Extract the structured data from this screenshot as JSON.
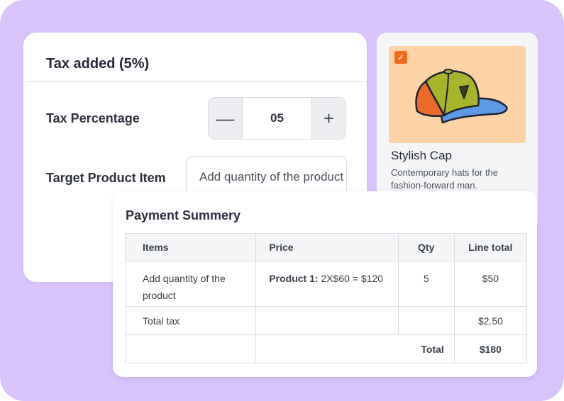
{
  "tax_card": {
    "title": "Tax added (5%)",
    "percentage_label": "Tax Percentage",
    "percentage_value": "05",
    "minus_symbol": "—",
    "plus_symbol": "+",
    "target_label": "Target Product Item",
    "target_placeholder": "Add quantity of the product"
  },
  "product": {
    "name": "Stylish Cap",
    "description": "Contemporary hats for the fashion-forward man.",
    "checked_symbol": "✓",
    "image_icon": "cap-illustration",
    "accent_color": "#f26a1b",
    "image_bg_color": "#fdd3a4"
  },
  "summary": {
    "title": "Payment Summery",
    "headers": [
      "Items",
      "Price",
      "Qty",
      "Line total"
    ],
    "rows": [
      {
        "item": "Add quantity of the product",
        "price_label": "Product 1:",
        "price_value": " 2X$60 = $120",
        "qty": "5",
        "line_total": "$50"
      },
      {
        "item": "Total tax",
        "price_label": "",
        "price_value": "",
        "qty": "",
        "line_total": "$2.50"
      }
    ],
    "total_label": "Total",
    "total_value": "$180"
  },
  "colors": {
    "background": "#d8c3fb",
    "card": "#ffffff"
  }
}
